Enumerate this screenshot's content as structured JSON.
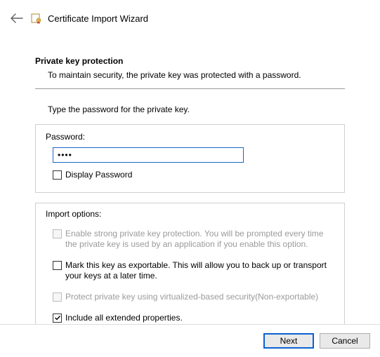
{
  "header": {
    "title": "Certificate Import Wizard"
  },
  "section": {
    "title": "Private key protection",
    "desc": "To maintain security, the private key was protected with a password."
  },
  "instruction": "Type the password for the private key.",
  "password": {
    "label": "Password:",
    "value": "••••",
    "display_label": "Display Password"
  },
  "import": {
    "label": "Import options:",
    "opt_strong": "Enable strong private key protection. You will be prompted every time the private key is used by an application if you enable this option.",
    "opt_exportable": "Mark this key as exportable. This will allow you to back up or transport your keys at a later time.",
    "opt_protect_vbs": "Protect private key using virtualized-based security(Non-exportable)",
    "opt_include_ext": "Include all extended properties."
  },
  "buttons": {
    "next": "Next",
    "cancel": "Cancel"
  }
}
